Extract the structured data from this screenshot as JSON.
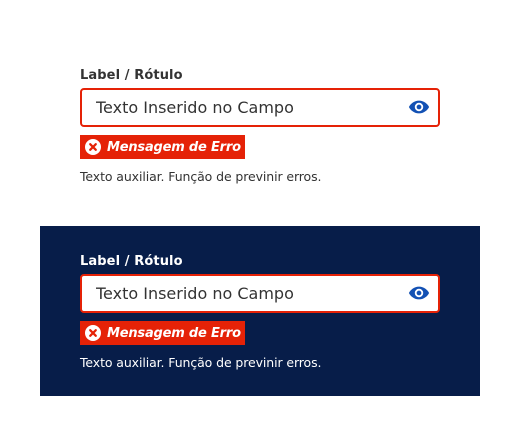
{
  "light": {
    "label": "Label / Rótulo",
    "input_value": "Texto Inserido no Campo",
    "error_message": "Mensagem de Erro",
    "helper_text": "Texto auxiliar. Função de previnir erros."
  },
  "dark": {
    "label": "Label / Rótulo",
    "input_value": "Texto Inserido no Campo",
    "error_message": "Mensagem de Erro",
    "helper_text": "Texto auxiliar. Função de previnir erros."
  },
  "icons": {
    "toggle": "eye-icon",
    "error": "error-circle-x-icon"
  },
  "colors": {
    "error": "#e52207",
    "accent": "#1351b4",
    "dark_background": "#071d49",
    "text": "#333333"
  }
}
